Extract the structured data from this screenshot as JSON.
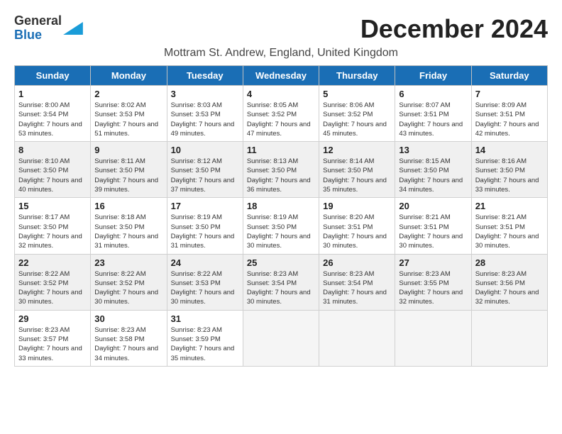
{
  "logo": {
    "line1": "General",
    "line2": "Blue",
    "icon_color": "#1a9cd8"
  },
  "title": "December 2024",
  "location": "Mottram St. Andrew, England, United Kingdom",
  "days_of_week": [
    "Sunday",
    "Monday",
    "Tuesday",
    "Wednesday",
    "Thursday",
    "Friday",
    "Saturday"
  ],
  "weeks": [
    {
      "shaded": false,
      "days": [
        {
          "num": "1",
          "sunrise": "8:00 AM",
          "sunset": "3:54 PM",
          "daylight": "7 hours and 53 minutes."
        },
        {
          "num": "2",
          "sunrise": "8:02 AM",
          "sunset": "3:53 PM",
          "daylight": "7 hours and 51 minutes."
        },
        {
          "num": "3",
          "sunrise": "8:03 AM",
          "sunset": "3:53 PM",
          "daylight": "7 hours and 49 minutes."
        },
        {
          "num": "4",
          "sunrise": "8:05 AM",
          "sunset": "3:52 PM",
          "daylight": "7 hours and 47 minutes."
        },
        {
          "num": "5",
          "sunrise": "8:06 AM",
          "sunset": "3:52 PM",
          "daylight": "7 hours and 45 minutes."
        },
        {
          "num": "6",
          "sunrise": "8:07 AM",
          "sunset": "3:51 PM",
          "daylight": "7 hours and 43 minutes."
        },
        {
          "num": "7",
          "sunrise": "8:09 AM",
          "sunset": "3:51 PM",
          "daylight": "7 hours and 42 minutes."
        }
      ]
    },
    {
      "shaded": true,
      "days": [
        {
          "num": "8",
          "sunrise": "8:10 AM",
          "sunset": "3:50 PM",
          "daylight": "7 hours and 40 minutes."
        },
        {
          "num": "9",
          "sunrise": "8:11 AM",
          "sunset": "3:50 PM",
          "daylight": "7 hours and 39 minutes."
        },
        {
          "num": "10",
          "sunrise": "8:12 AM",
          "sunset": "3:50 PM",
          "daylight": "7 hours and 37 minutes."
        },
        {
          "num": "11",
          "sunrise": "8:13 AM",
          "sunset": "3:50 PM",
          "daylight": "7 hours and 36 minutes."
        },
        {
          "num": "12",
          "sunrise": "8:14 AM",
          "sunset": "3:50 PM",
          "daylight": "7 hours and 35 minutes."
        },
        {
          "num": "13",
          "sunrise": "8:15 AM",
          "sunset": "3:50 PM",
          "daylight": "7 hours and 34 minutes."
        },
        {
          "num": "14",
          "sunrise": "8:16 AM",
          "sunset": "3:50 PM",
          "daylight": "7 hours and 33 minutes."
        }
      ]
    },
    {
      "shaded": false,
      "days": [
        {
          "num": "15",
          "sunrise": "8:17 AM",
          "sunset": "3:50 PM",
          "daylight": "7 hours and 32 minutes."
        },
        {
          "num": "16",
          "sunrise": "8:18 AM",
          "sunset": "3:50 PM",
          "daylight": "7 hours and 31 minutes."
        },
        {
          "num": "17",
          "sunrise": "8:19 AM",
          "sunset": "3:50 PM",
          "daylight": "7 hours and 31 minutes."
        },
        {
          "num": "18",
          "sunrise": "8:19 AM",
          "sunset": "3:50 PM",
          "daylight": "7 hours and 30 minutes."
        },
        {
          "num": "19",
          "sunrise": "8:20 AM",
          "sunset": "3:51 PM",
          "daylight": "7 hours and 30 minutes."
        },
        {
          "num": "20",
          "sunrise": "8:21 AM",
          "sunset": "3:51 PM",
          "daylight": "7 hours and 30 minutes."
        },
        {
          "num": "21",
          "sunrise": "8:21 AM",
          "sunset": "3:51 PM",
          "daylight": "7 hours and 30 minutes."
        }
      ]
    },
    {
      "shaded": true,
      "days": [
        {
          "num": "22",
          "sunrise": "8:22 AM",
          "sunset": "3:52 PM",
          "daylight": "7 hours and 30 minutes."
        },
        {
          "num": "23",
          "sunrise": "8:22 AM",
          "sunset": "3:52 PM",
          "daylight": "7 hours and 30 minutes."
        },
        {
          "num": "24",
          "sunrise": "8:22 AM",
          "sunset": "3:53 PM",
          "daylight": "7 hours and 30 minutes."
        },
        {
          "num": "25",
          "sunrise": "8:23 AM",
          "sunset": "3:54 PM",
          "daylight": "7 hours and 30 minutes."
        },
        {
          "num": "26",
          "sunrise": "8:23 AM",
          "sunset": "3:54 PM",
          "daylight": "7 hours and 31 minutes."
        },
        {
          "num": "27",
          "sunrise": "8:23 AM",
          "sunset": "3:55 PM",
          "daylight": "7 hours and 32 minutes."
        },
        {
          "num": "28",
          "sunrise": "8:23 AM",
          "sunset": "3:56 PM",
          "daylight": "7 hours and 32 minutes."
        }
      ]
    },
    {
      "shaded": false,
      "days": [
        {
          "num": "29",
          "sunrise": "8:23 AM",
          "sunset": "3:57 PM",
          "daylight": "7 hours and 33 minutes."
        },
        {
          "num": "30",
          "sunrise": "8:23 AM",
          "sunset": "3:58 PM",
          "daylight": "7 hours and 34 minutes."
        },
        {
          "num": "31",
          "sunrise": "8:23 AM",
          "sunset": "3:59 PM",
          "daylight": "7 hours and 35 minutes."
        },
        null,
        null,
        null,
        null
      ]
    }
  ]
}
